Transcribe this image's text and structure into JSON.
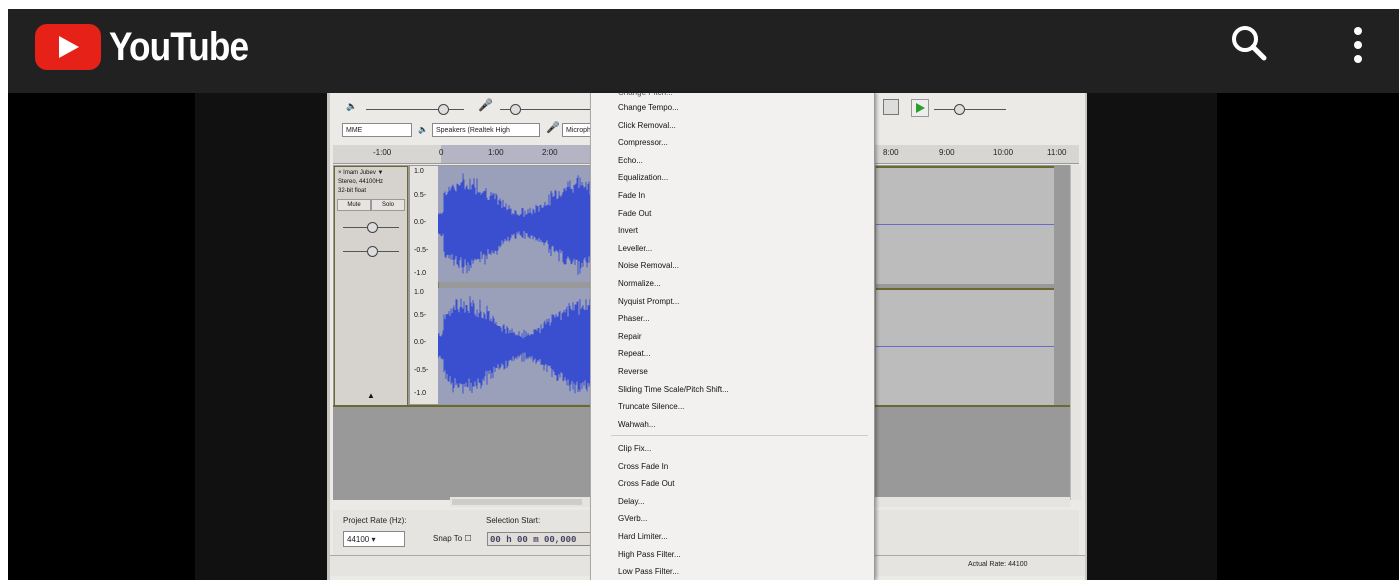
{
  "youtube": {
    "brand": "YouTube",
    "icons": {
      "search": "search-icon",
      "menu": "more-vert-icon"
    },
    "colors": {
      "bar": "#212121",
      "red": "#e62117"
    }
  },
  "audacity": {
    "device_host": "MME",
    "output_device": "Speakers (Realtek High",
    "input_device": "Microph",
    "ruler_left": [
      "-1:00",
      "0",
      "1:00",
      "2:00"
    ],
    "ruler_right": [
      "8:00",
      "9:00",
      "10:00",
      "11:00"
    ],
    "track": {
      "name": "Imam Jubev",
      "format": "Stereo, 44100Hz",
      "bits": "32-bit float",
      "mute": "Mute",
      "solo": "Solo"
    },
    "scale_top": [
      "1.0",
      "0.5-",
      "0.0-",
      "-0.5-",
      "-1.0"
    ],
    "scale_bottom": [
      "1.0",
      "0.5-",
      "0.0-",
      "-0.5-",
      "-1.0"
    ],
    "project_rate_label": "Project Rate (Hz):",
    "project_rate_value": "44100",
    "snap_to": "Snap To",
    "selection_start_label": "Selection Start:",
    "selection_start_value": "00 h 00 m 00,000",
    "actual_rate": "Actual Rate: 44100",
    "wave_color": "#3a4fd0"
  },
  "effect_menu": {
    "items": [
      "Change Tempo...",
      "Click Removal...",
      "Compressor...",
      "Echo...",
      "Equalization...",
      "Fade In",
      "Fade Out",
      "Invert",
      "Leveller...",
      "Noise Removal...",
      "Normalize...",
      "Nyquist Prompt...",
      "Phaser...",
      "Repair",
      "Repeat...",
      "Reverse",
      "Sliding Time Scale/Pitch Shift...",
      "Truncate Silence...",
      "Wahwah..."
    ],
    "items2": [
      "Clip Fix...",
      "Cross Fade In",
      "Cross Fade Out",
      "Delay...",
      "GVerb...",
      "Hard Limiter...",
      "High Pass Filter...",
      "Low Pass Filter..."
    ]
  }
}
